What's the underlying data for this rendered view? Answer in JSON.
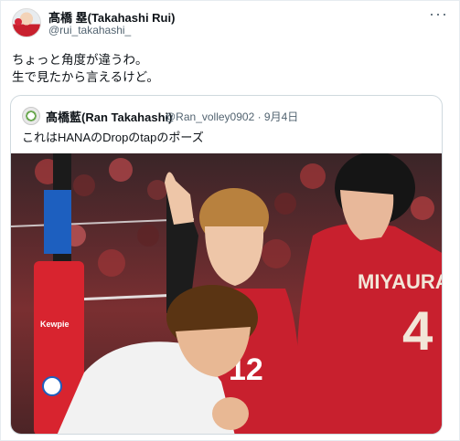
{
  "author": {
    "name": "髙橋 塁(Takahashi Rui)",
    "handle": "@rui_takahashi_",
    "avatar_icon": "profile-avatar"
  },
  "more_icon": "ellipsis-icon",
  "more_label": "···",
  "tweet_lines": [
    "ちょっと角度が違うわ。",
    "生で見たから言えるけど。"
  ],
  "quoted": {
    "name": "髙橋藍(Ran Takahashi)",
    "meta": "@Ran_volley0902 · 9月4日",
    "text": "これはHANAのDropのtapのポーズ",
    "photo": {
      "jersey_name": "MIYAURA",
      "jersey_number_right": "4",
      "jersey_number_center": "12",
      "sponsor_text": "Kewpie",
      "colors": {
        "jersey_red": "#c8202e",
        "crowd_red": "#8e2a2c",
        "pole_red": "#d8242f"
      }
    }
  }
}
